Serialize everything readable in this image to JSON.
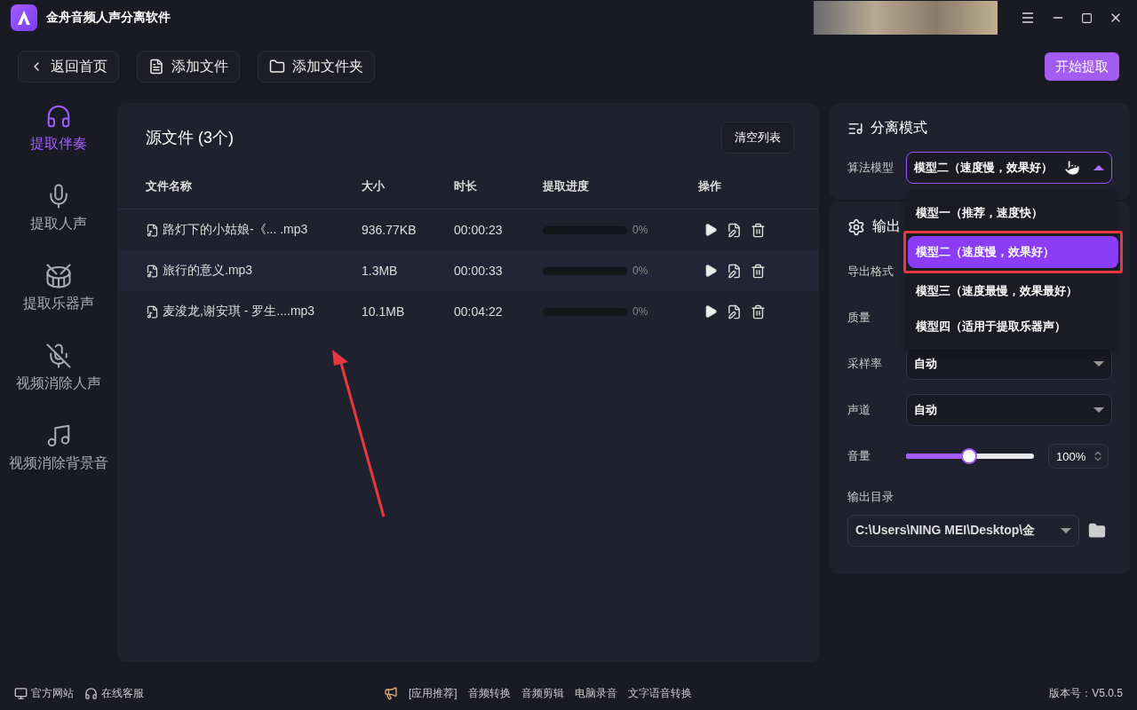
{
  "window": {
    "title": "金舟音频人声分离软件"
  },
  "toolbar": {
    "back": "返回首页",
    "add_file": "添加文件",
    "add_folder": "添加文件夹",
    "start": "开始提取"
  },
  "sidebar": {
    "items": [
      {
        "label": "提取伴奏",
        "selected": true,
        "kind": "headphones"
      },
      {
        "label": "提取人声",
        "selected": false,
        "kind": "mic-headphones"
      },
      {
        "label": "提取乐器声",
        "selected": false,
        "kind": "drum"
      },
      {
        "label": "视频消除人声",
        "selected": false,
        "kind": "mic-off"
      },
      {
        "label": "视频消除背景音",
        "selected": false,
        "kind": "note-off"
      }
    ]
  },
  "files": {
    "title": "源文件 (3个)",
    "clear": "清空列表",
    "columns": [
      "文件名称",
      "大小",
      "时长",
      "提取进度",
      "操作"
    ],
    "rows": [
      {
        "name": "路灯下的小姑娘-《...   .mp3",
        "size": "936.77KB",
        "duration": "00:00:23",
        "level": 0,
        "percent": "0%"
      },
      {
        "name": "旅行的意义.mp3",
        "size": "1.3MB",
        "duration": "00:00:33",
        "level": 0,
        "percent": "0%"
      },
      {
        "name": "麦浚龙,谢安琪 - 罗生....mp3",
        "size": "10.1MB",
        "duration": "00:04:22",
        "level": 0,
        "percent": "0%"
      }
    ]
  },
  "mode": {
    "title": "分离模式",
    "label": "算法模型",
    "value": "模型二（速度慢，效果好）",
    "expanded": true,
    "options": [
      {
        "label": "模型一（推荐，速度快）",
        "selected": false,
        "highlighted": false
      },
      {
        "label": "模型二（速度慢，效果好）",
        "selected": true,
        "highlighted": true
      },
      {
        "label": "模型三（速度最慢，效果最好）",
        "selected": false,
        "highlighted": false
      },
      {
        "label": "模型四（适用于提取乐器声）",
        "selected": false,
        "highlighted": false
      }
    ]
  },
  "output": {
    "title": "输出",
    "rows": [
      {
        "kind": "covered",
        "label": "导出格式"
      },
      {
        "kind": "covered",
        "label": "质量"
      },
      {
        "kind": "select",
        "label": "采样率",
        "value": "自动"
      },
      {
        "kind": "select",
        "label": "声道",
        "value": "自动"
      },
      {
        "kind": "slider",
        "label": "音量",
        "level": 0.49,
        "value": "100%"
      }
    ],
    "dir_label": "输出目录",
    "dir": "C:\\Users\\NING MEI\\Desktop\\金"
  },
  "footer": {
    "left": [
      "官方网站",
      "在线客服"
    ],
    "recommend": "[应用推荐]",
    "apps": [
      "音频转换",
      "音频剪辑",
      "电脑录音",
      "文字语音转换"
    ],
    "version": "版本号：V5.0.5"
  }
}
